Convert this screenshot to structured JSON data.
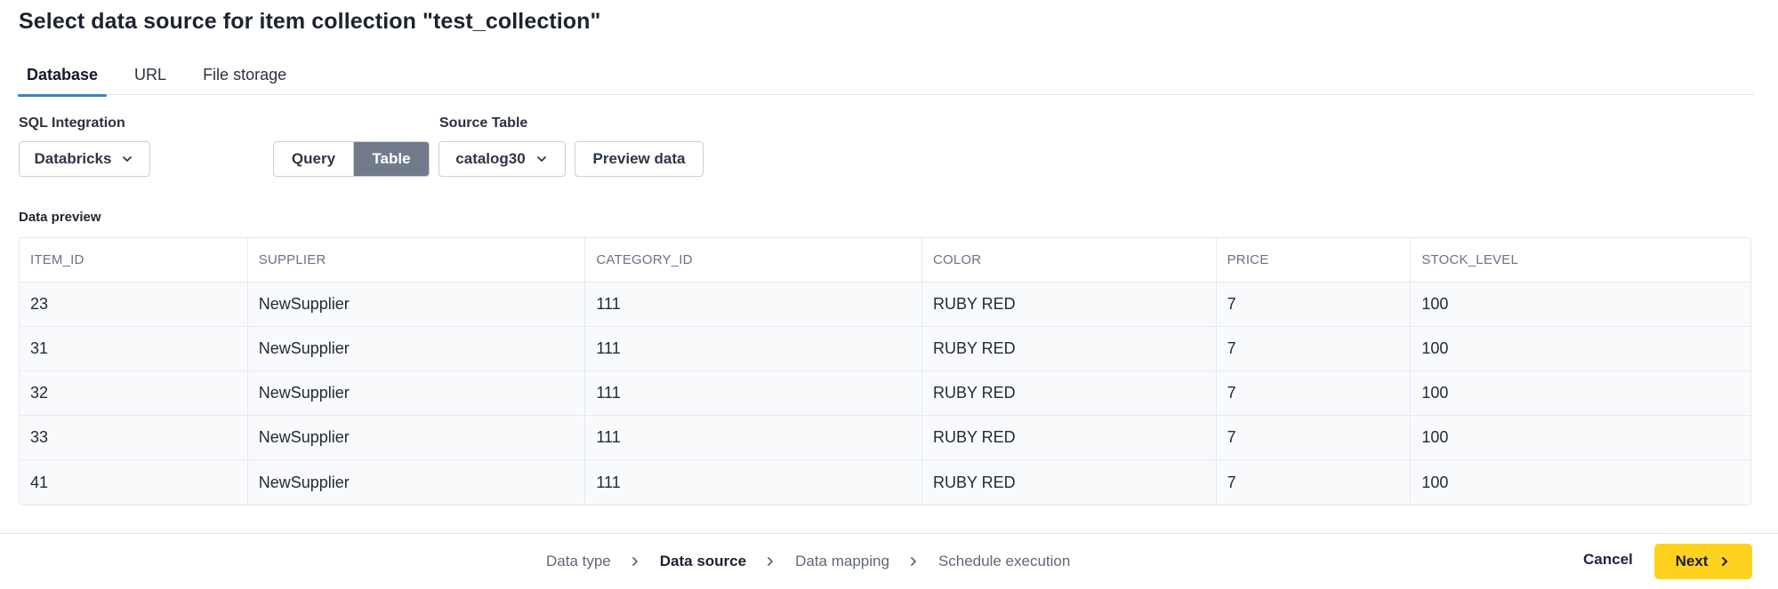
{
  "dialog": {
    "title": "Select data source for item collection \"test_collection\""
  },
  "tabs": [
    {
      "label": "Database",
      "active": true
    },
    {
      "label": "URL",
      "active": false
    },
    {
      "label": "File storage",
      "active": false
    }
  ],
  "form": {
    "sql_integration_label": "SQL Integration",
    "sql_integration_value": "Databricks",
    "mode_options": [
      {
        "label": "Query",
        "selected": false
      },
      {
        "label": "Table",
        "selected": true
      }
    ],
    "source_table_label": "Source Table",
    "source_table_value": "catalog30",
    "preview_button": "Preview data"
  },
  "preview": {
    "label": "Data preview",
    "columns": [
      "ITEM_ID",
      "SUPPLIER",
      "CATEGORY_ID",
      "COLOR",
      "PRICE",
      "STOCK_LEVEL"
    ],
    "rows": [
      [
        "23",
        "NewSupplier",
        "111",
        "RUBY RED",
        "7",
        "100"
      ],
      [
        "31",
        "NewSupplier",
        "111",
        "RUBY RED",
        "7",
        "100"
      ],
      [
        "32",
        "NewSupplier",
        "111",
        "RUBY RED",
        "7",
        "100"
      ],
      [
        "33",
        "NewSupplier",
        "111",
        "RUBY RED",
        "7",
        "100"
      ],
      [
        "41",
        "NewSupplier",
        "111",
        "RUBY RED",
        "7",
        "100"
      ]
    ]
  },
  "wizard": {
    "steps": [
      {
        "label": "Data type",
        "current": false
      },
      {
        "label": "Data source",
        "current": true
      },
      {
        "label": "Data mapping",
        "current": false
      },
      {
        "label": "Schedule execution",
        "current": false
      }
    ],
    "cancel_label": "Cancel",
    "next_label": "Next"
  },
  "icons": {
    "dropdown": "chevron-down-icon",
    "step_separator": "chevron-right-icon",
    "next": "chevron-right-icon"
  },
  "colors": {
    "active_tab_underline": "#3b82c4",
    "selected_segment": "#717b8c",
    "primary_button": "#ffd21f"
  }
}
